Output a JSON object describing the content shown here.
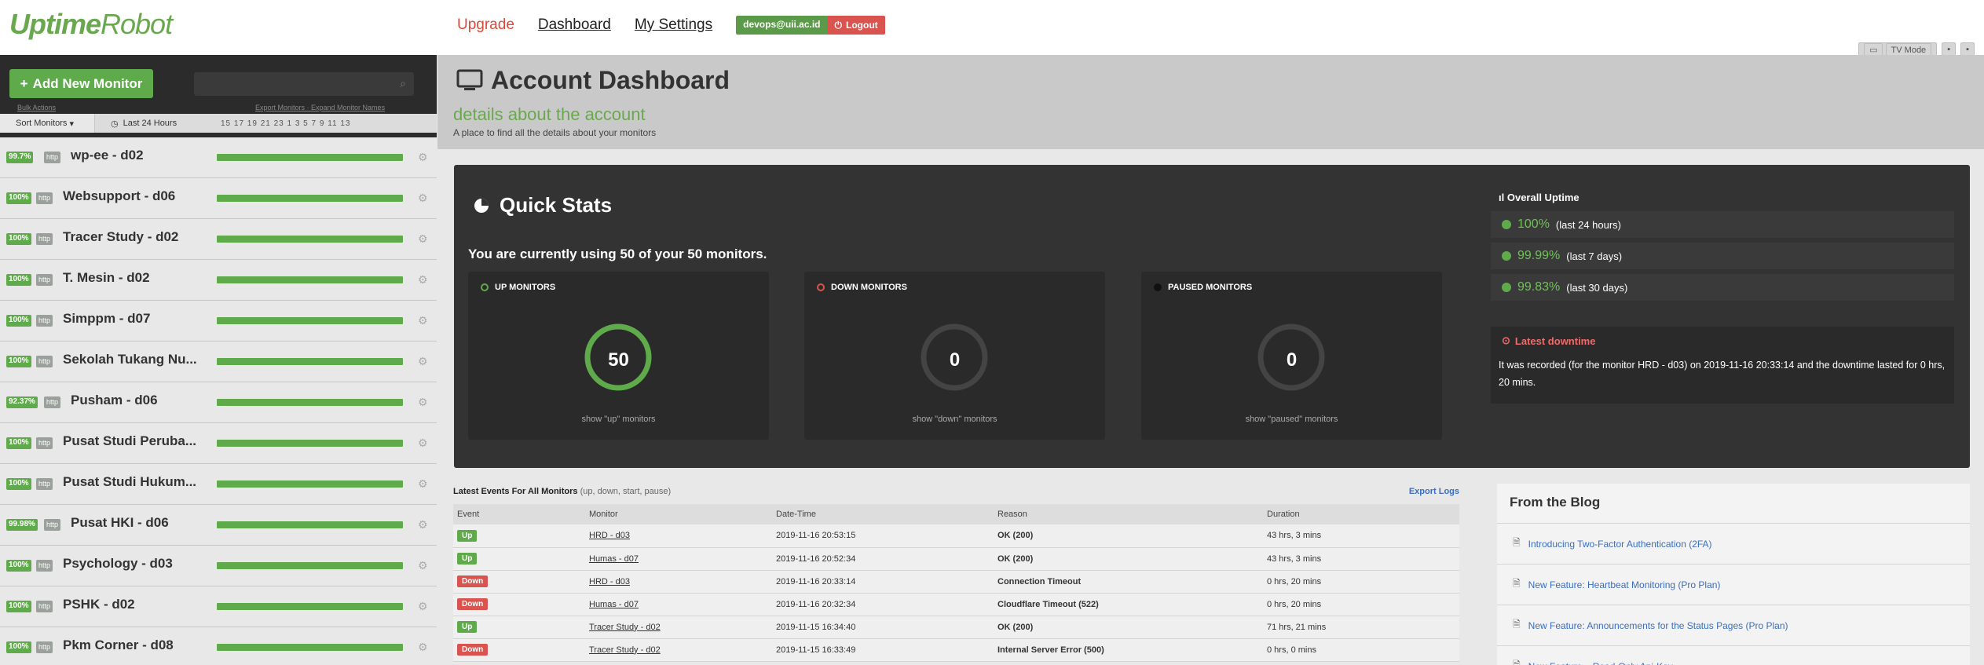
{
  "app": {
    "logo_bold": "Uptime",
    "logo_normal": "Robot"
  },
  "nav": {
    "upgrade": "Upgrade",
    "dashboard": "Dashboard",
    "settings": "My Settings",
    "email": "devops@uii.ac.id",
    "logout": "Logout"
  },
  "tv": {
    "tv_mode": "TV Mode"
  },
  "sidebar": {
    "add_monitor": "Add New Monitor",
    "search_placeholder": "",
    "bulk_actions": "Bulk Actions",
    "export_monitors": "Export Monitors · Expand Monitor Names",
    "sort_label": "Sort Monitors",
    "last_24": "Last 24 Hours",
    "hours": "15 17 19 21 23 1 3 5 7 9 11 13",
    "monitors": [
      {
        "uptime": "99.7%",
        "type": "http",
        "name": "wp-ee - d02"
      },
      {
        "uptime": "100%",
        "type": "http",
        "name": "Websupport - d06"
      },
      {
        "uptime": "100%",
        "type": "http",
        "name": "Tracer Study - d02"
      },
      {
        "uptime": "100%",
        "type": "http",
        "name": "T. Mesin - d02"
      },
      {
        "uptime": "100%",
        "type": "http",
        "name": "Simppm - d07"
      },
      {
        "uptime": "100%",
        "type": "http",
        "name": "Sekolah Tukang Nu..."
      },
      {
        "uptime": "92.37%",
        "type": "http",
        "name": "Pusham - d06"
      },
      {
        "uptime": "100%",
        "type": "http",
        "name": "Pusat Studi Peruba..."
      },
      {
        "uptime": "100%",
        "type": "http",
        "name": "Pusat Studi Hukum..."
      },
      {
        "uptime": "99.98%",
        "type": "http",
        "name": "Pusat HKI - d06"
      },
      {
        "uptime": "100%",
        "type": "http",
        "name": "Psychology - d03"
      },
      {
        "uptime": "100%",
        "type": "http",
        "name": "PSHK - d02"
      },
      {
        "uptime": "100%",
        "type": "http",
        "name": "Pkm Corner - d08"
      }
    ]
  },
  "header": {
    "title": "Account Dashboard",
    "subtitle": "details about the account",
    "description": "A place to find all the details about your monitors"
  },
  "quick_stats": {
    "title": "Quick Stats",
    "using": "You are currently using 50 of your 50 monitors.",
    "up": {
      "label": "UP MONITORS",
      "count": "50",
      "link": "show \"up\" monitors",
      "color": "#5fab4b"
    },
    "down": {
      "label": "DOWN MONITORS",
      "count": "0",
      "link": "show \"down\" monitors",
      "color": "#d9534f"
    },
    "paused": {
      "label": "PAUSED MONITORS",
      "count": "0",
      "link": "show \"paused\" monitors",
      "color": "#111111"
    }
  },
  "overall_uptime": {
    "title": "Overall Uptime",
    "rows": [
      {
        "value": "100%",
        "period": "(last 24 hours)"
      },
      {
        "value": "99.99%",
        "period": "(last 7 days)"
      },
      {
        "value": "99.83%",
        "period": "(last 30 days)"
      }
    ]
  },
  "latest_downtime": {
    "title": "Latest downtime",
    "text": "It was recorded (for the monitor HRD - d03) on 2019-11-16 20:33:14 and the downtime lasted for 0 hrs, 20 mins."
  },
  "events": {
    "title": "Latest Events For All Monitors",
    "title_sub": "(up, down, start, pause)",
    "export": "Export Logs",
    "columns": [
      "Event",
      "Monitor",
      "Date-Time",
      "Reason",
      "Duration"
    ],
    "rows": [
      {
        "event": "Up",
        "monitor": "HRD - d03",
        "datetime": "2019-11-16 20:53:15",
        "reason": "OK (200)",
        "duration": "43 hrs, 3 mins"
      },
      {
        "event": "Up",
        "monitor": "Humas - d07",
        "datetime": "2019-11-16 20:52:34",
        "reason": "OK (200)",
        "duration": "43 hrs, 3 mins"
      },
      {
        "event": "Down",
        "monitor": "HRD - d03",
        "datetime": "2019-11-16 20:33:14",
        "reason": "Connection Timeout",
        "duration": "0 hrs, 20 mins"
      },
      {
        "event": "Down",
        "monitor": "Humas - d07",
        "datetime": "2019-11-16 20:32:34",
        "reason": "Cloudflare Timeout (522)",
        "duration": "0 hrs, 20 mins"
      },
      {
        "event": "Up",
        "monitor": "Tracer Study - d02",
        "datetime": "2019-11-15 16:34:40",
        "reason": "OK (200)",
        "duration": "71 hrs, 21 mins"
      },
      {
        "event": "Down",
        "monitor": "Tracer Study - d02",
        "datetime": "2019-11-15 16:33:49",
        "reason": "Internal Server Error (500)",
        "duration": "0 hrs, 0 mins"
      }
    ]
  },
  "blog": {
    "title": "From the Blog",
    "posts": [
      "Introducing Two-Factor Authentication (2FA)",
      "New Feature: Heartbeat Monitoring (Pro Plan)",
      "New Feature: Announcements for the Status Pages (Pro Plan)",
      "New Feature – Read-Only Api-Key"
    ]
  }
}
